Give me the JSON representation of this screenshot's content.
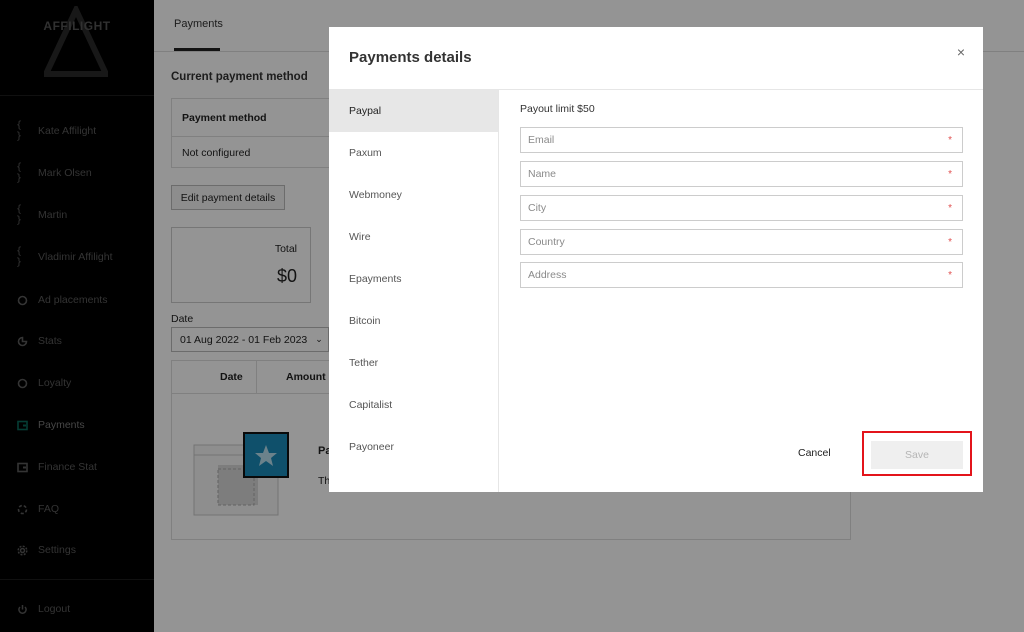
{
  "app": {
    "logo_text": "AFFILIGHT"
  },
  "sidebar": {
    "items": [
      {
        "label": "Kate Affilight",
        "icon": "braces-icon"
      },
      {
        "label": "Mark Olsen",
        "icon": "braces-icon"
      },
      {
        "label": "Martin",
        "icon": "braces-icon"
      },
      {
        "label": "Vladimir Affilight",
        "icon": "braces-icon"
      },
      {
        "label": "Ad placements",
        "icon": "circle-icon"
      },
      {
        "label": "Stats",
        "icon": "pie-icon"
      },
      {
        "label": "Loyalty",
        "icon": "circle-icon"
      },
      {
        "label": "Payments",
        "icon": "wallet-icon",
        "active": true
      },
      {
        "label": "Finance Stat",
        "icon": "wallet-icon"
      },
      {
        "label": "FAQ",
        "icon": "lifebuoy-icon"
      },
      {
        "label": "Settings",
        "icon": "gear-icon"
      }
    ],
    "logout": {
      "label": "Logout",
      "icon": "power-icon"
    }
  },
  "page": {
    "tab": "Payments",
    "current_method_title": "Current payment method",
    "method_table": {
      "header": "Payment method",
      "value": "Not configured"
    },
    "edit_button": "Edit payment details",
    "total": {
      "label": "Total",
      "value": "$0"
    },
    "date": {
      "label": "Date",
      "value": "01 Aug 2022 - 01 Feb 2023"
    },
    "list_table": {
      "columns": [
        "Date",
        "Amount"
      ]
    },
    "empty_state": {
      "title": "Pa",
      "text": "Th"
    }
  },
  "modal": {
    "title": "Payments details",
    "close_glyph": "×",
    "methods": [
      "Paypal",
      "Paxum",
      "Webmoney",
      "Wire",
      "Epayments",
      "Bitcoin",
      "Tether",
      "Capitalist",
      "Payoneer"
    ],
    "active_method": "Paypal",
    "payout_limit": "Payout limit $50",
    "fields": [
      {
        "placeholder": "Email",
        "required_mark": "*"
      },
      {
        "placeholder": "Name",
        "required_mark": "*"
      },
      {
        "placeholder": "City",
        "required_mark": "*"
      },
      {
        "placeholder": "Country",
        "required_mark": "*"
      },
      {
        "placeholder": "Address",
        "required_mark": "*"
      }
    ],
    "cancel_label": "Cancel",
    "save_label": "Save"
  },
  "colors": {
    "highlight": "#e3141b",
    "accent": "#0a6a5a",
    "sidebar_bg": "#000000"
  }
}
